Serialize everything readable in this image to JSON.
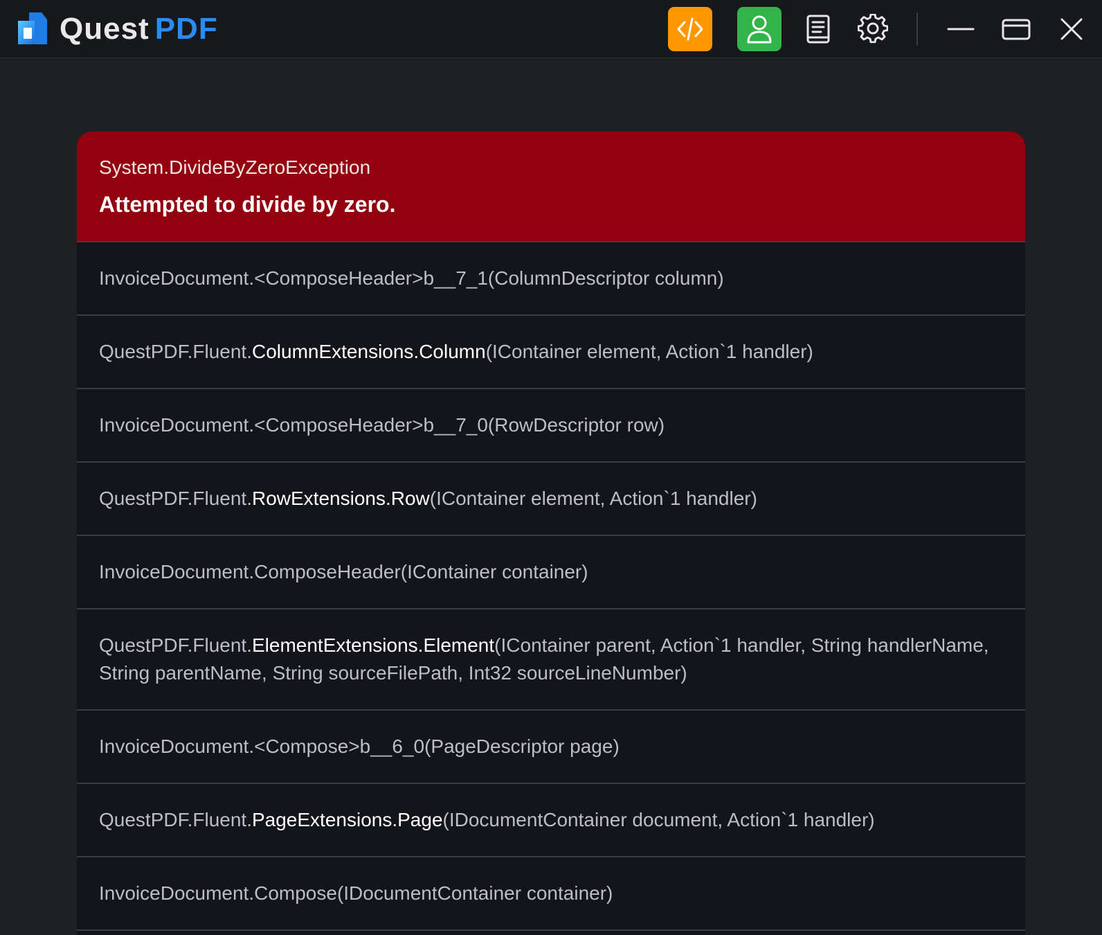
{
  "app": {
    "brand_part1": "Quest",
    "brand_part2": "PDF"
  },
  "toolbar": {
    "buttons": [
      {
        "name": "code-button",
        "icon": "code-icon",
        "color": "#ff9800"
      },
      {
        "name": "user-button",
        "icon": "user-icon",
        "color": "#33b44a"
      },
      {
        "name": "documentation-button",
        "icon": "book-icon"
      },
      {
        "name": "settings-button",
        "icon": "gear-icon"
      },
      {
        "name": "minimize-button",
        "icon": "minimize-icon"
      },
      {
        "name": "maximize-button",
        "icon": "maximize-icon"
      },
      {
        "name": "close-button",
        "icon": "close-icon"
      }
    ]
  },
  "error": {
    "type": "System.DivideByZeroException",
    "message": "Attempted to divide by zero.",
    "header_color": "#93000e"
  },
  "stack_frames": [
    {
      "pre": "InvoiceDocument.<ComposeHeader>b__7_1(ColumnDescriptor column)",
      "highlight": "",
      "post": ""
    },
    {
      "pre": "QuestPDF.Fluent.",
      "highlight": "ColumnExtensions.Column",
      "post": "(IContainer element, Action`1 handler)"
    },
    {
      "pre": "InvoiceDocument.<ComposeHeader>b__7_0(RowDescriptor row)",
      "highlight": "",
      "post": ""
    },
    {
      "pre": "QuestPDF.Fluent.",
      "highlight": "RowExtensions.Row",
      "post": "(IContainer element, Action`1 handler)"
    },
    {
      "pre": "InvoiceDocument.ComposeHeader(IContainer container)",
      "highlight": "",
      "post": ""
    },
    {
      "pre": "QuestPDF.Fluent.",
      "highlight": "ElementExtensions.Element",
      "post": "(IContainer parent, Action`1 handler, String handlerName, String parentName, String sourceFilePath, Int32 sourceLineNumber)"
    },
    {
      "pre": "InvoiceDocument.<Compose>b__6_0(PageDescriptor page)",
      "highlight": "",
      "post": ""
    },
    {
      "pre": "QuestPDF.Fluent.",
      "highlight": "PageExtensions.Page",
      "post": "(IDocumentContainer document, Action`1 handler)"
    },
    {
      "pre": "InvoiceDocument.Compose(IDocumentContainer container)",
      "highlight": "",
      "post": ""
    }
  ]
}
